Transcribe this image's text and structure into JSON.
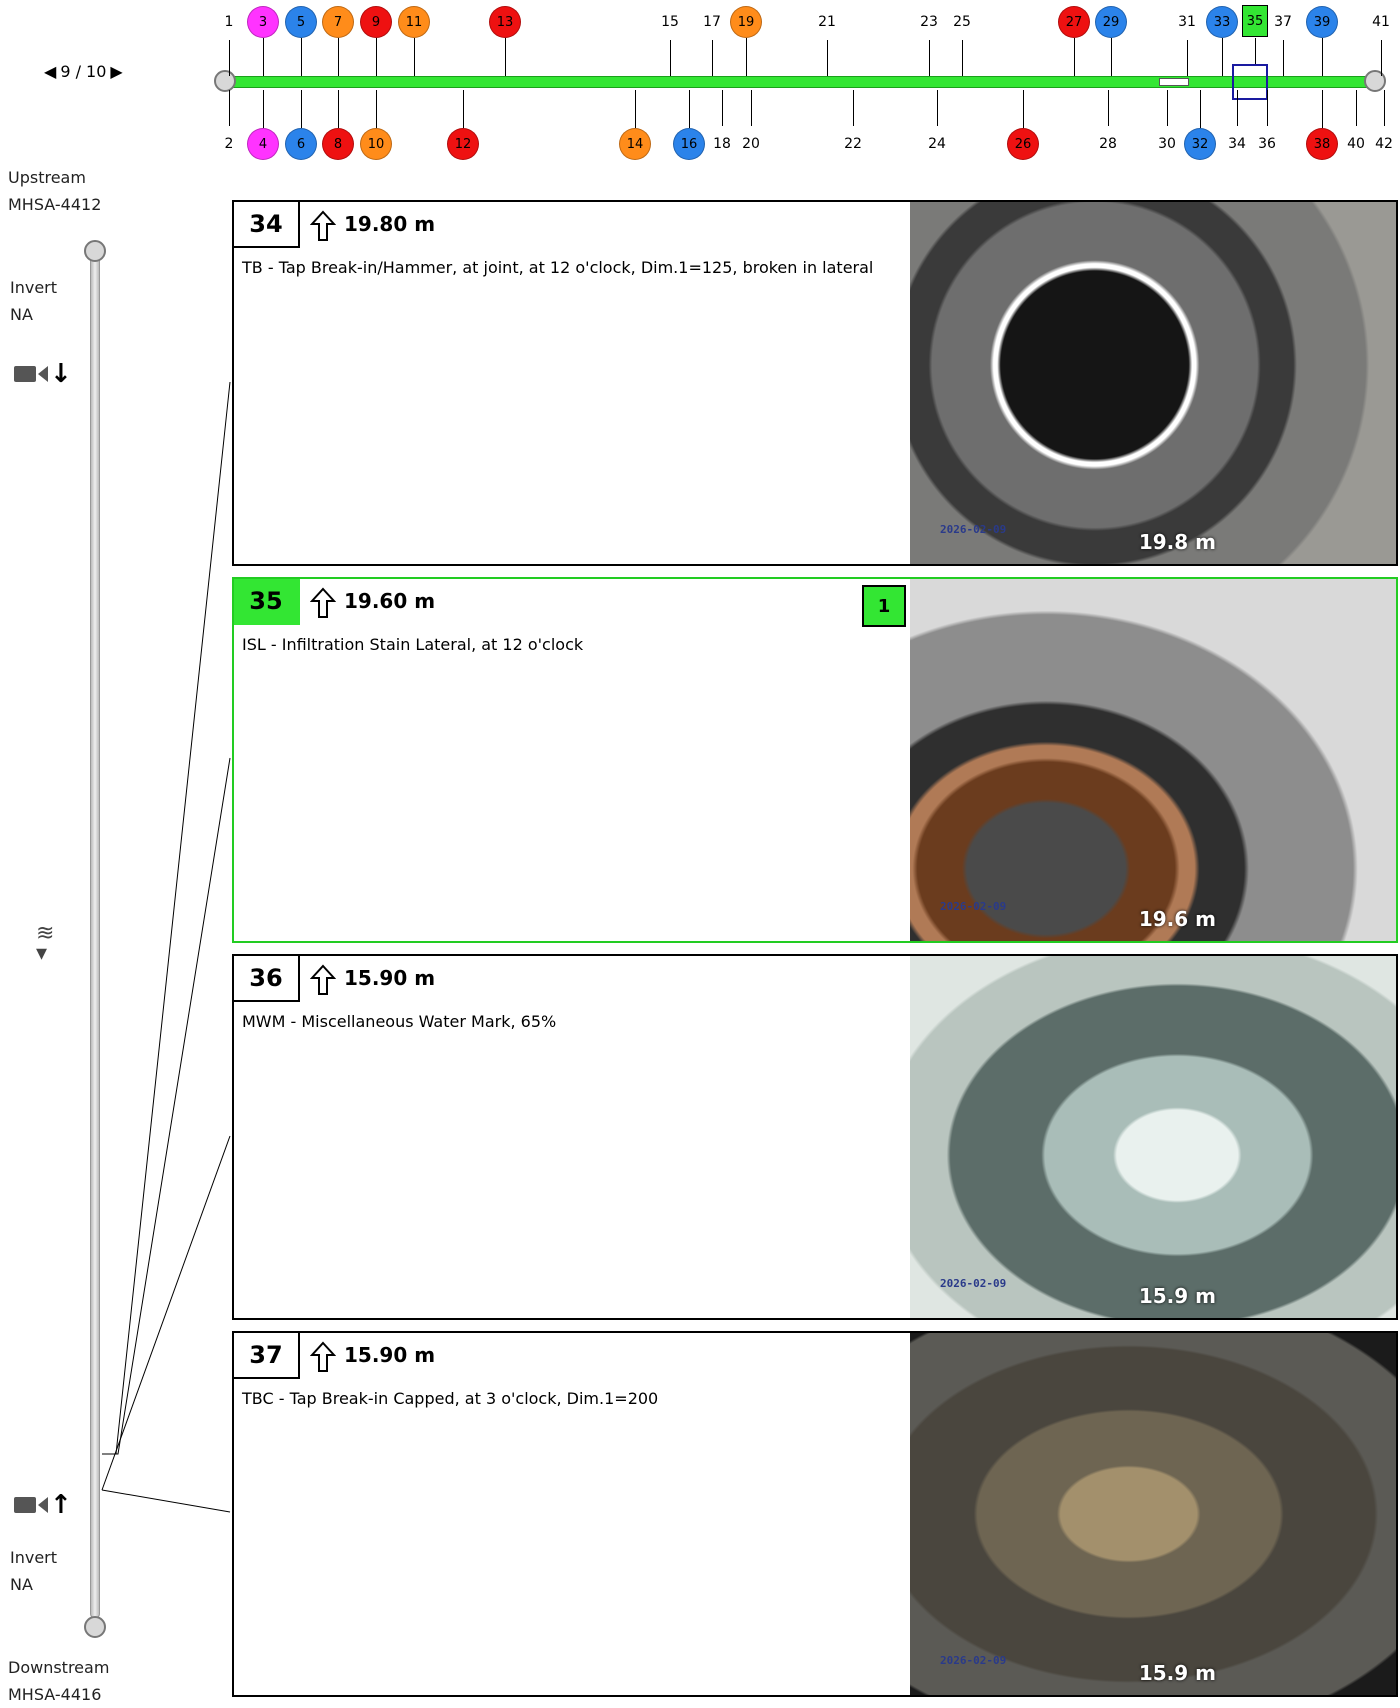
{
  "pager": {
    "prev": "◀",
    "label": "9 / 10",
    "next": "▶"
  },
  "timeline": {
    "top_numbers": [
      "1",
      "15",
      "17",
      "21",
      "23",
      "25",
      "31",
      "37",
      "41"
    ],
    "bottom_numbers": [
      "2",
      "18",
      "20",
      "22",
      "24",
      "28",
      "30",
      "34",
      "36",
      "40",
      "42"
    ],
    "top_markers": [
      {
        "label": "3",
        "color": "#ff33ff"
      },
      {
        "label": "5",
        "color": "#2b83ea"
      },
      {
        "label": "7",
        "color": "#ff8c1a"
      },
      {
        "label": "9",
        "color": "#ee1111"
      },
      {
        "label": "11",
        "color": "#ff8c1a"
      },
      {
        "label": "13",
        "color": "#ee1111"
      },
      {
        "label": "19",
        "color": "#ff8c1a"
      },
      {
        "label": "27",
        "color": "#ee1111"
      },
      {
        "label": "29",
        "color": "#2b83ea"
      },
      {
        "label": "33",
        "color": "#2b83ea"
      },
      {
        "label": "39",
        "color": "#2b83ea"
      }
    ],
    "selected_marker": {
      "label": "35",
      "color": "#33e633"
    },
    "bottom_markers": [
      {
        "label": "4",
        "color": "#ff33ff"
      },
      {
        "label": "6",
        "color": "#2b83ea"
      },
      {
        "label": "8",
        "color": "#ee1111"
      },
      {
        "label": "10",
        "color": "#ff8c1a"
      },
      {
        "label": "12",
        "color": "#ee1111"
      },
      {
        "label": "14",
        "color": "#ff8c1a"
      },
      {
        "label": "16",
        "color": "#2b83ea"
      },
      {
        "label": "26",
        "color": "#ee1111"
      },
      {
        "label": "32",
        "color": "#2b83ea"
      },
      {
        "label": "38",
        "color": "#ee1111"
      }
    ]
  },
  "left_panel": {
    "upstream_label": "Upstream",
    "upstream_id": "MHSA-4412",
    "top_invert_label": "Invert",
    "top_invert_value": "NA",
    "bottom_invert_label": "Invert",
    "bottom_invert_value": "NA",
    "downstream_label": "Downstream",
    "downstream_id": "MHSA-4416",
    "camera_icon": "camera-icon",
    "flow_icon": "flow-direction-icon"
  },
  "observations": [
    {
      "number": "34",
      "distance": "19.80 m",
      "description": "TB - Tap Break-in/Hammer, at joint, at 12 o'clock, Dim.1=125, broken in lateral",
      "photo_date": "2026-02-09",
      "photo_distance": "19.8 m",
      "badge": ""
    },
    {
      "number": "35",
      "distance": "19.60 m",
      "description": "ISL - Infiltration Stain Lateral, at 12 o'clock",
      "photo_date": "2026-02-09",
      "photo_distance": "19.6 m",
      "badge": "1"
    },
    {
      "number": "36",
      "distance": "15.90 m",
      "description": "MWM - Miscellaneous Water Mark, 65%",
      "photo_date": "2026-02-09",
      "photo_distance": "15.9 m",
      "badge": ""
    },
    {
      "number": "37",
      "distance": "15.90 m",
      "description": "TBC - Tap Break-in Capped, at 3 o'clock, Dim.1=200",
      "photo_date": "2026-02-09",
      "photo_distance": "15.9 m",
      "badge": ""
    }
  ],
  "colors": {
    "active": "#33e633",
    "pipe": "#33e633",
    "selection": "#1a1aa0"
  }
}
